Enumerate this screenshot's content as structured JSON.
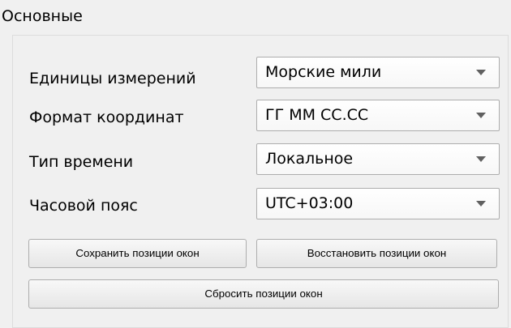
{
  "group": {
    "title": "Основные"
  },
  "settings": [
    {
      "label": "Единицы измерений",
      "value": "Морские мили"
    },
    {
      "label": "Формат координат",
      "value": "ГГ ММ СС.СС"
    },
    {
      "label": "Тип времени",
      "value": "Локальное"
    },
    {
      "label": "Часовой пояс",
      "value": "UTC+03:00"
    }
  ],
  "buttons": {
    "save_positions": "Сохранить позиции окон",
    "restore_positions": "Восстановить позиции окон",
    "reset_positions": "Сбросить позиции окон"
  },
  "icons": {
    "dropdown": "chevron-down-icon"
  }
}
